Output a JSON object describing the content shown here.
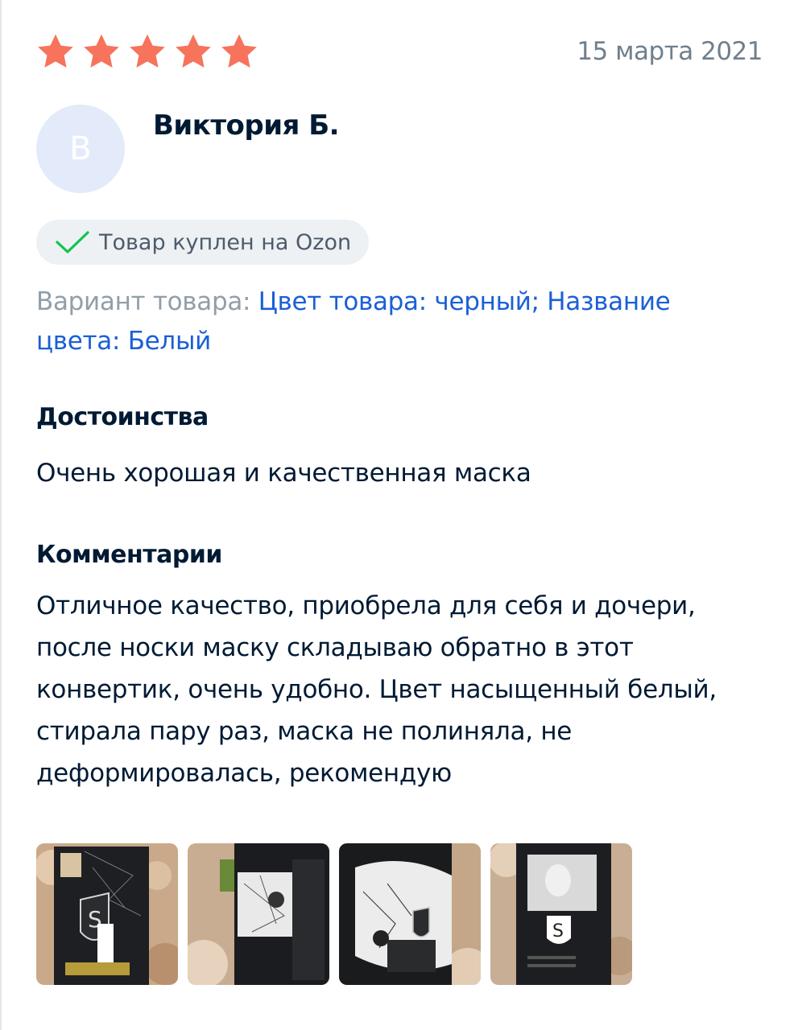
{
  "review": {
    "rating": 5,
    "rating_max": 5,
    "date": "15 марта 2021",
    "author": {
      "initial": "В",
      "name": "Виктория Б."
    },
    "badge": {
      "icon": "check-icon",
      "text": "Товар куплен на Ozon"
    },
    "variant": {
      "label": "Вариант товара:",
      "value": "Цвет товара: черный; Название цвета: Белый"
    },
    "pros": {
      "title": "Достоинства",
      "text": "Очень хорошая и качественная маска"
    },
    "comments": {
      "title": "Комментарии",
      "text": "Отличное качество, приобрела для себя и дочери, после носки маску складываю обратно в этот конвертик, очень удобно. Цвет насыщенный белый, стирала пару раз, маска не полиняла, не деформировалась, рекомендую"
    },
    "photos": [
      {
        "name": "review-photo-1"
      },
      {
        "name": "review-photo-2"
      },
      {
        "name": "review-photo-3"
      },
      {
        "name": "review-photo-4"
      }
    ]
  },
  "colors": {
    "star": "#f7735c",
    "link": "#1b5fd6",
    "check": "#10c44c",
    "text": "#001a34",
    "muted": "#707f8d"
  }
}
